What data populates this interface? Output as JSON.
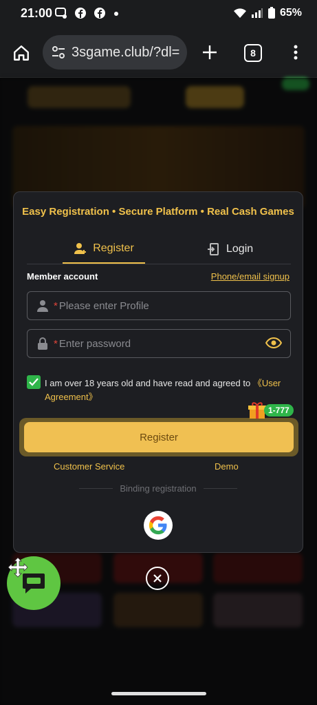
{
  "status_bar": {
    "time": "21:00",
    "battery": "65%"
  },
  "browser": {
    "url": "3sgame.club/?dl=",
    "tab_count": "8"
  },
  "dialog": {
    "headline": "Easy Registration • Secure Platform • Real Cash Games",
    "tabs": {
      "register": "Register",
      "login": "Login"
    },
    "member_label": "Member account",
    "phone_link": "Phone/email signup",
    "profile_field": {
      "required": "*",
      "placeholder": "Please enter Profile"
    },
    "password_field": {
      "required": "*",
      "placeholder": "Enter password"
    },
    "agreement": {
      "text": "I am over 18 years old and have read and agreed to ",
      "link": "《User Agreement》",
      "checked": true
    },
    "gift_badge": "1-777",
    "register_button": "Register",
    "customer_service": "Customer Service",
    "demo": "Demo",
    "binding": "Binding registration"
  },
  "colors": {
    "accent": "#f0c14b",
    "button": "#f0c052",
    "success": "#2fb54a",
    "chat": "#5fc642"
  },
  "icons": [
    "wifi-icon",
    "signal-icon",
    "battery-icon",
    "home-icon",
    "site-info-icon",
    "plus-icon",
    "tabs-icon",
    "more-icon",
    "user-add-icon",
    "login-icon",
    "user-icon",
    "lock-icon",
    "eye-icon",
    "check-icon",
    "gift-icon",
    "google-icon",
    "close-icon",
    "chat-icon",
    "move-icon"
  ]
}
